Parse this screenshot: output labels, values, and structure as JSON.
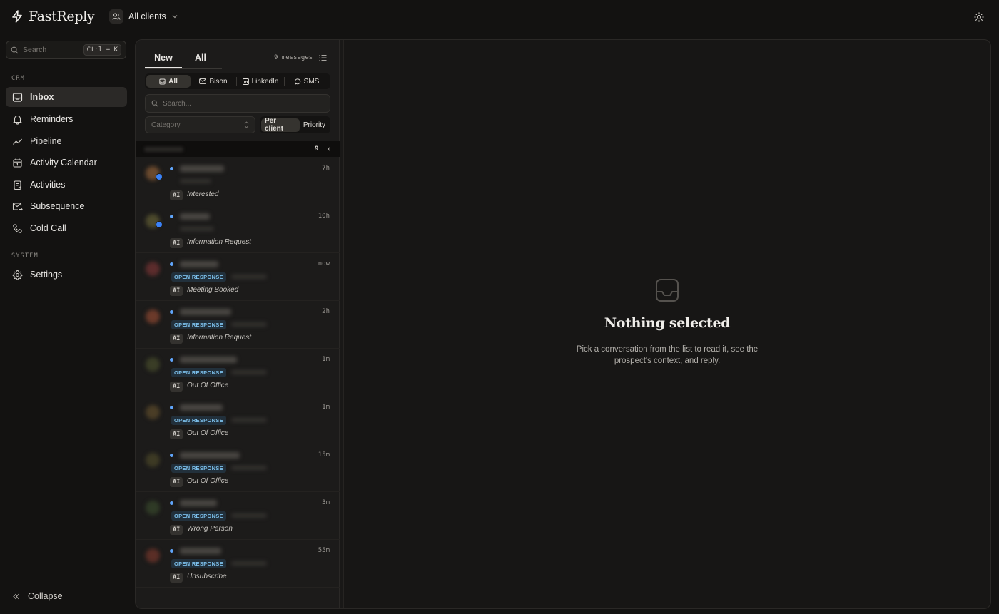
{
  "app": {
    "name": "FastReply"
  },
  "client_switch": {
    "label": "All clients"
  },
  "sidebar": {
    "search": {
      "placeholder": "Search",
      "shortcut": "Ctrl + K"
    },
    "sections": [
      {
        "label": "CRM"
      },
      {
        "label": "SYSTEM"
      }
    ],
    "crm_items": [
      {
        "label": "Inbox",
        "active": true,
        "icon": "inbox-icon"
      },
      {
        "label": "Reminders",
        "icon": "bell-icon"
      },
      {
        "label": "Pipeline",
        "icon": "trend-icon"
      },
      {
        "label": "Activity Calendar",
        "icon": "calendar-icon"
      },
      {
        "label": "Activities",
        "icon": "clipboard-icon"
      },
      {
        "label": "Subsequence",
        "icon": "mail-forward-icon"
      },
      {
        "label": "Cold Call",
        "icon": "phone-icon"
      }
    ],
    "system_items": [
      {
        "label": "Settings",
        "icon": "gear-icon"
      }
    ],
    "collapse_label": "Collapse"
  },
  "list": {
    "tabs": [
      {
        "label": "New",
        "active": true
      },
      {
        "label": "All"
      }
    ],
    "message_count": "9 messages",
    "channels": [
      {
        "label": "All",
        "active": true
      },
      {
        "label": "Bison"
      },
      {
        "label": "LinkedIn"
      },
      {
        "label": "SMS"
      }
    ],
    "search_placeholder": "Search...",
    "category_placeholder": "Category",
    "grouping": [
      {
        "label": "Per client",
        "active": true
      },
      {
        "label": "Priority"
      }
    ],
    "group_count": "9",
    "rows": [
      {
        "time": "7h",
        "ai": "AI",
        "category": "Interested",
        "open": ""
      },
      {
        "time": "10h",
        "ai": "AI",
        "category": "Information Request",
        "open": ""
      },
      {
        "time": "now",
        "ai": "AI",
        "category": "Meeting Booked",
        "open": "OPEN RESPONSE"
      },
      {
        "time": "2h",
        "ai": "AI",
        "category": "Information Request",
        "open": "OPEN RESPONSE"
      },
      {
        "time": "1m",
        "ai": "AI",
        "category": "Out Of Office",
        "open": "OPEN RESPONSE"
      },
      {
        "time": "1m",
        "ai": "AI",
        "category": "Out Of Office",
        "open": "OPEN RESPONSE"
      },
      {
        "time": "15m",
        "ai": "AI",
        "category": "Out Of Office",
        "open": "OPEN RESPONSE"
      },
      {
        "time": "3m",
        "ai": "AI",
        "category": "Wrong Person",
        "open": "OPEN RESPONSE"
      },
      {
        "time": "55m",
        "ai": "AI",
        "category": "Unsubscribe",
        "open": "OPEN RESPONSE"
      }
    ]
  },
  "empty_state": {
    "title": "Nothing selected",
    "line1": "Pick a conversation from the list to read it, see the",
    "line2": "prospect's context, and reply."
  },
  "colors": {
    "background": "#131211",
    "accent_blue": "#60a5fa",
    "open_response": "#7cc0ec"
  }
}
